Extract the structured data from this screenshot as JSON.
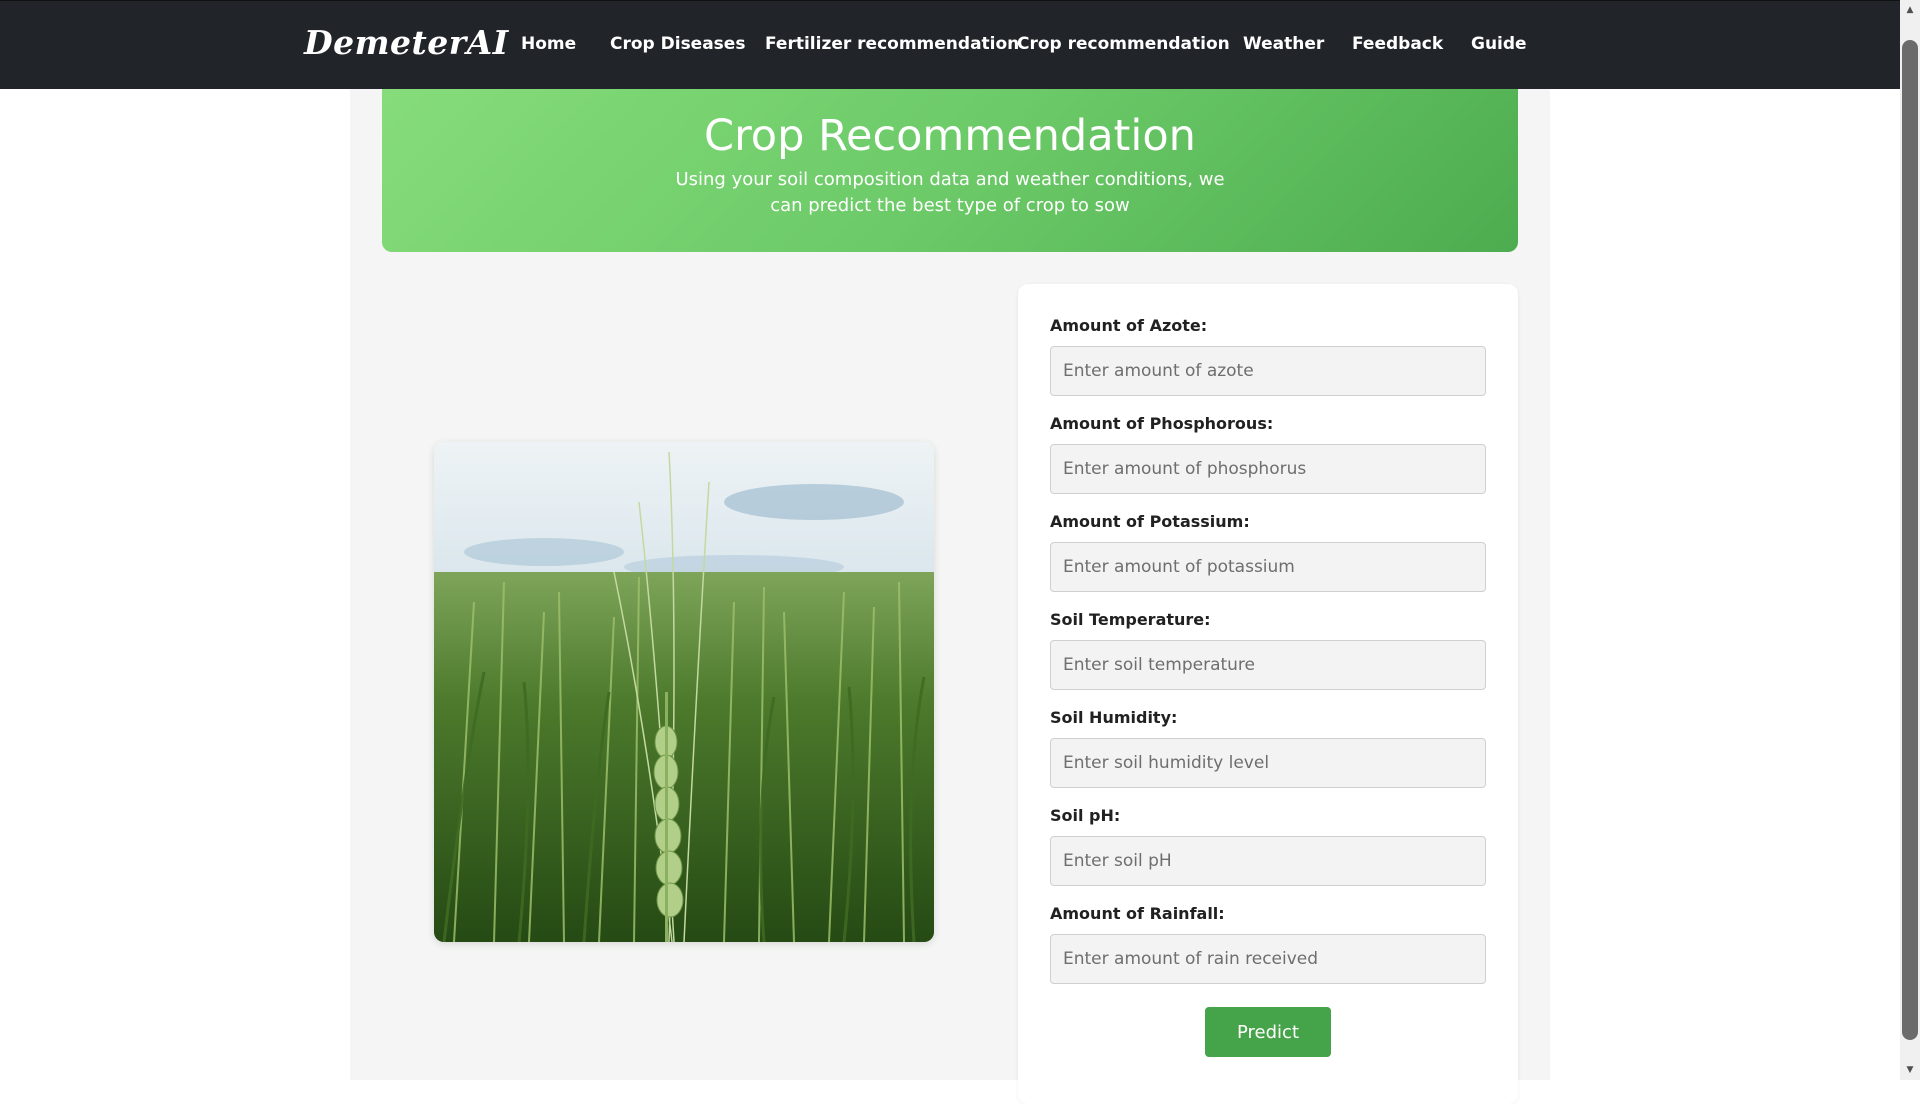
{
  "navbar": {
    "brand": "DemeterAI",
    "items": [
      {
        "label": "Home"
      },
      {
        "label": "Crop Diseases"
      },
      {
        "label": "Fertilizer recommendation"
      },
      {
        "label": "Crop recommendation"
      },
      {
        "label": "Weather"
      },
      {
        "label": "Feedback"
      },
      {
        "label": "Guide"
      }
    ]
  },
  "hero": {
    "title": "Crop Recommendation",
    "subtitle": "Using your soil composition data and weather conditions, we can predict the best type of crop to sow"
  },
  "form": {
    "fields": [
      {
        "label": "Amount of Azote:",
        "placeholder": "Enter amount of azote",
        "value": ""
      },
      {
        "label": "Amount of Phosphorous:",
        "placeholder": "Enter amount of phosphorus",
        "value": ""
      },
      {
        "label": "Amount of Potassium:",
        "placeholder": "Enter amount of potassium",
        "value": ""
      },
      {
        "label": "Soil Temperature:",
        "placeholder": "Enter soil temperature",
        "value": ""
      },
      {
        "label": "Soil Humidity:",
        "placeholder": "Enter soil humidity level",
        "value": ""
      },
      {
        "label": "Soil pH:",
        "placeholder": "Enter soil pH",
        "value": ""
      },
      {
        "label": "Amount of Rainfall:",
        "placeholder": "Enter amount of rain received",
        "value": ""
      }
    ],
    "submit_label": "Predict"
  },
  "colors": {
    "navbar_bg": "#212529",
    "hero_gradient_start": "#86dc7a",
    "hero_gradient_end": "#4dac4f",
    "button_bg": "#45a449",
    "page_bg": "#f4f5f4"
  },
  "icons": {
    "scroll_up": "triangle-up-icon",
    "scroll_down": "triangle-down-icon"
  }
}
